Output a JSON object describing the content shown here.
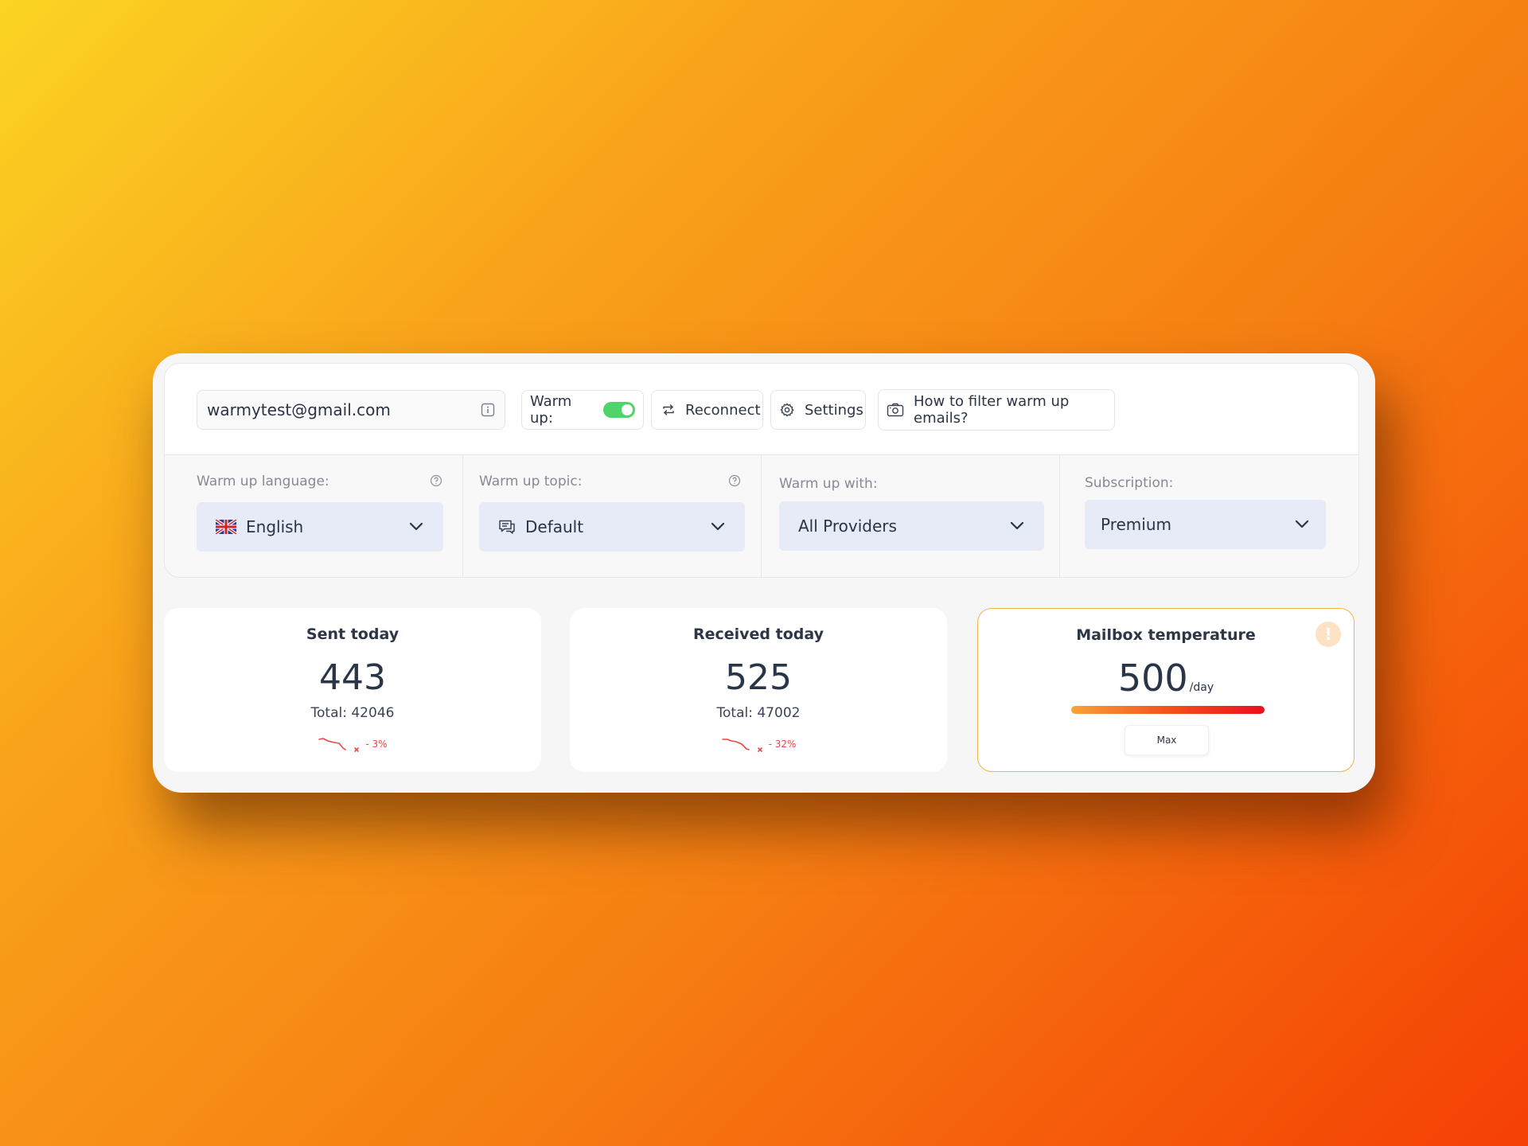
{
  "account": {
    "email": "warmytest@gmail.com"
  },
  "toolbar": {
    "warmup_label": "Warm up:",
    "warmup_enabled": true,
    "reconnect_label": "Reconnect",
    "settings_label": "Settings",
    "filter_label": "How to filter warm up emails?"
  },
  "options": {
    "language": {
      "label": "Warm up language:",
      "value": "English",
      "flag_icon": "uk-flag-icon"
    },
    "topic": {
      "label": "Warm up topic:",
      "value": "Default",
      "icon": "chat-icon"
    },
    "providers": {
      "label": "Warm up with:",
      "value": "All Providers"
    },
    "subscription": {
      "label": "Subscription:",
      "value": "Premium"
    }
  },
  "stats": {
    "sent": {
      "title": "Sent today",
      "value": "443",
      "total": "Total: 42046",
      "trend": "- 3%"
    },
    "received": {
      "title": "Received today",
      "value": "525",
      "total": "Total: 47002",
      "trend": "- 32%"
    },
    "temperature": {
      "title": "Mailbox temperature",
      "value": "500",
      "unit": "/day",
      "level": 1.0,
      "max_label": "Max",
      "warning_icon": "!"
    }
  },
  "colors": {
    "accent_toggle": "#4fd46a",
    "select_bg": "#e6ebf7",
    "trend_down": "#f04545",
    "temperature_border": "#f7b24a"
  }
}
